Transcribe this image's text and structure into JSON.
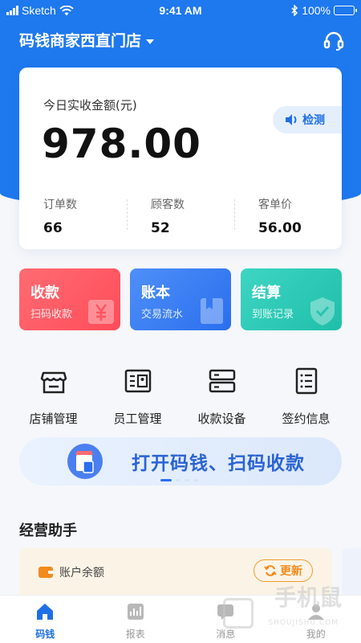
{
  "status_bar": {
    "carrier": "Sketch",
    "time": "9:41 AM",
    "battery": "100%"
  },
  "header": {
    "store_name": "码钱商家西直门店"
  },
  "summary": {
    "title": "今日实收金额(元)",
    "amount": "978.00",
    "detect_label": "检测",
    "stats": [
      {
        "label": "订单数",
        "value": "66"
      },
      {
        "label": "顾客数",
        "value": "52"
      },
      {
        "label": "客单价",
        "value": "56.00"
      }
    ]
  },
  "cards": [
    {
      "title": "收款",
      "subtitle": "扫码收款",
      "color": "#ff5a64"
    },
    {
      "title": "账本",
      "subtitle": "交易流水",
      "color": "#3a7ff3"
    },
    {
      "title": "结算",
      "subtitle": "到账记录",
      "color": "#2cc9b5"
    }
  ],
  "quick_actions": [
    {
      "label": "店铺管理",
      "icon": "store-icon"
    },
    {
      "label": "员工管理",
      "icon": "id-card-icon"
    },
    {
      "label": "收款设备",
      "icon": "device-icon"
    },
    {
      "label": "签约信息",
      "icon": "document-icon"
    }
  ],
  "banner": {
    "text": "打开码钱、扫码收款"
  },
  "section": {
    "title": "经营助手"
  },
  "balance": {
    "label": "账户余额",
    "refresh_label": "更新"
  },
  "tabbar": [
    {
      "label": "码钱",
      "icon": "home-icon",
      "active": true
    },
    {
      "label": "报表",
      "icon": "chart-icon",
      "active": false
    },
    {
      "label": "消息",
      "icon": "message-icon",
      "active": false
    },
    {
      "label": "我的",
      "icon": "user-icon",
      "active": false
    }
  ],
  "watermark": {
    "text": "手机鼠",
    "sub": "SHOUJISHU.COM"
  },
  "colors": {
    "primary": "#1e78ee",
    "accent_orange": "#f28a1c"
  }
}
